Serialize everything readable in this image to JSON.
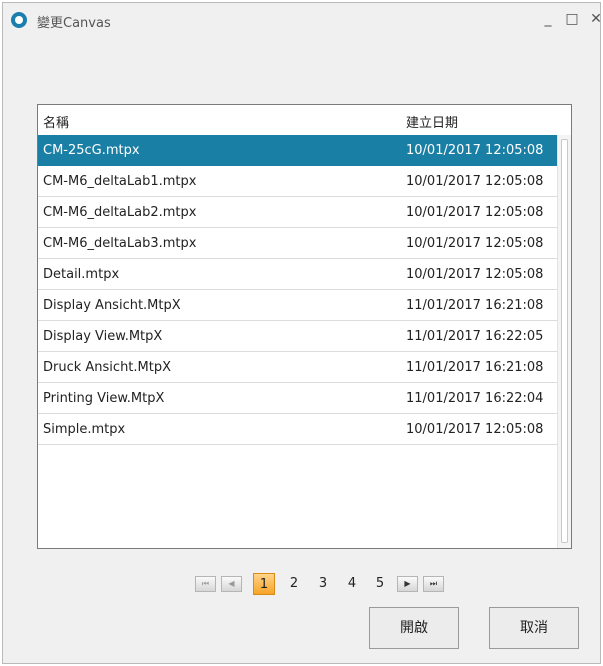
{
  "window": {
    "title": "變更Canvas",
    "minimize": "_",
    "maximize": "□",
    "close": "✕"
  },
  "list": {
    "columns": {
      "name": "名稱",
      "date": "建立日期"
    },
    "rows": [
      {
        "name": "CM-25cG.mtpx",
        "date": "10/01/2017 12:05:08",
        "selected": true
      },
      {
        "name": "CM-M6_deltaLab1.mtpx",
        "date": "10/01/2017 12:05:08"
      },
      {
        "name": "CM-M6_deltaLab2.mtpx",
        "date": "10/01/2017 12:05:08"
      },
      {
        "name": "CM-M6_deltaLab3.mtpx",
        "date": "10/01/2017 12:05:08"
      },
      {
        "name": "Detail.mtpx",
        "date": "10/01/2017 12:05:08"
      },
      {
        "name": "Display Ansicht.MtpX",
        "date": "11/01/2017 16:21:08"
      },
      {
        "name": "Display View.MtpX",
        "date": "11/01/2017 16:22:05"
      },
      {
        "name": "Druck Ansicht.MtpX",
        "date": "11/01/2017 16:21:08"
      },
      {
        "name": "Printing View.MtpX",
        "date": "11/01/2017 16:22:04"
      },
      {
        "name": "Simple.mtpx",
        "date": "10/01/2017 12:05:08"
      }
    ]
  },
  "pager": {
    "first_icon": "⏮",
    "prev_icon": "◀",
    "next_icon": "▶",
    "last_icon": "⏭",
    "pages": [
      "1",
      "2",
      "3",
      "4",
      "5"
    ],
    "current": "1"
  },
  "buttons": {
    "open": "開啟",
    "cancel": "取消"
  },
  "colors": {
    "selection": "#1a7fa4",
    "active_page": "#f7a428",
    "app_icon": "#1a7fae"
  }
}
